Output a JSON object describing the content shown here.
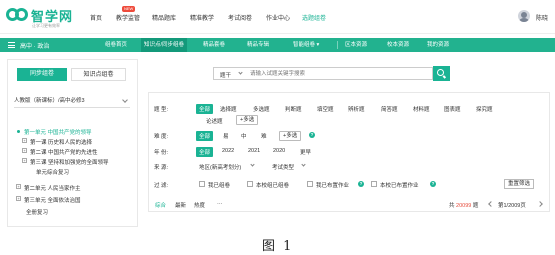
{
  "header": {
    "brand": "智学网",
    "brand_sub": "让学习更有效率",
    "nav": [
      "首页",
      "教学监管",
      "精品题库",
      "精准教学",
      "考试阅卷",
      "作业中心",
      "选题组卷"
    ],
    "nav_active_index": 6,
    "new_badge": "NEW",
    "user": "陈晓"
  },
  "greenbar": {
    "subject": "高中 · 政治",
    "tabs": [
      "组卷首页",
      "知识点/同步组卷",
      "精品套卷",
      "精品专辑",
      "智能组卷",
      "区本资源",
      "校本资源",
      "我的资源"
    ],
    "active_index": 1,
    "intelligent_chevron": "▾"
  },
  "left_panel": {
    "tab_sync": "同步组卷",
    "tab_knowledge": "知识点组卷",
    "book": "人教版（新课标）/高中必修3",
    "tree": [
      "第一单元 中国共产党的领导",
      "第一课 历史和人民的选择",
      "第二课 中国共产党的先进性",
      "第三课 坚持和加强党的全面领导",
      "单元综合复习",
      "第二单元 人民当家作主",
      "第三单元 全面依法治国",
      "全册复习"
    ]
  },
  "search": {
    "scope": "题干",
    "placeholder": "请输入试题关键字搜索"
  },
  "filters": {
    "type_label": "题  型:",
    "types": [
      "全部",
      "选择题",
      "多选题",
      "判断题",
      "填空题",
      "辨析题",
      "简答题",
      "材料题",
      "图表题",
      "探究题",
      "论述题"
    ],
    "type_add": "+多选",
    "difficulty_label": "难  度:",
    "difficulties": [
      "全部",
      "易",
      "中",
      "难"
    ],
    "diff_add": "+多选",
    "year_label": "年  份:",
    "years": [
      "全部",
      "2022",
      "2021",
      "2020",
      "更早"
    ],
    "source_label": "来  源:",
    "region": "地区(新高考划分)",
    "exam_type": "考试类型",
    "filter_label": "过  滤:",
    "filters": [
      "我已组卷",
      "本校组已组卷",
      "我已布置作业",
      "本校已布置作业"
    ],
    "reset": "重置筛选"
  },
  "toolbar": {
    "sorts": [
      "综合",
      "最新",
      "热度"
    ],
    "more": "···",
    "total_prefix": "共",
    "total": "20099",
    "total_suffix": "题",
    "page": "第1/2009页"
  },
  "caption": "图 1",
  "colors": {
    "accent": "#1ab394",
    "bar": "#22b28f",
    "highlight": "#e64a3a"
  }
}
